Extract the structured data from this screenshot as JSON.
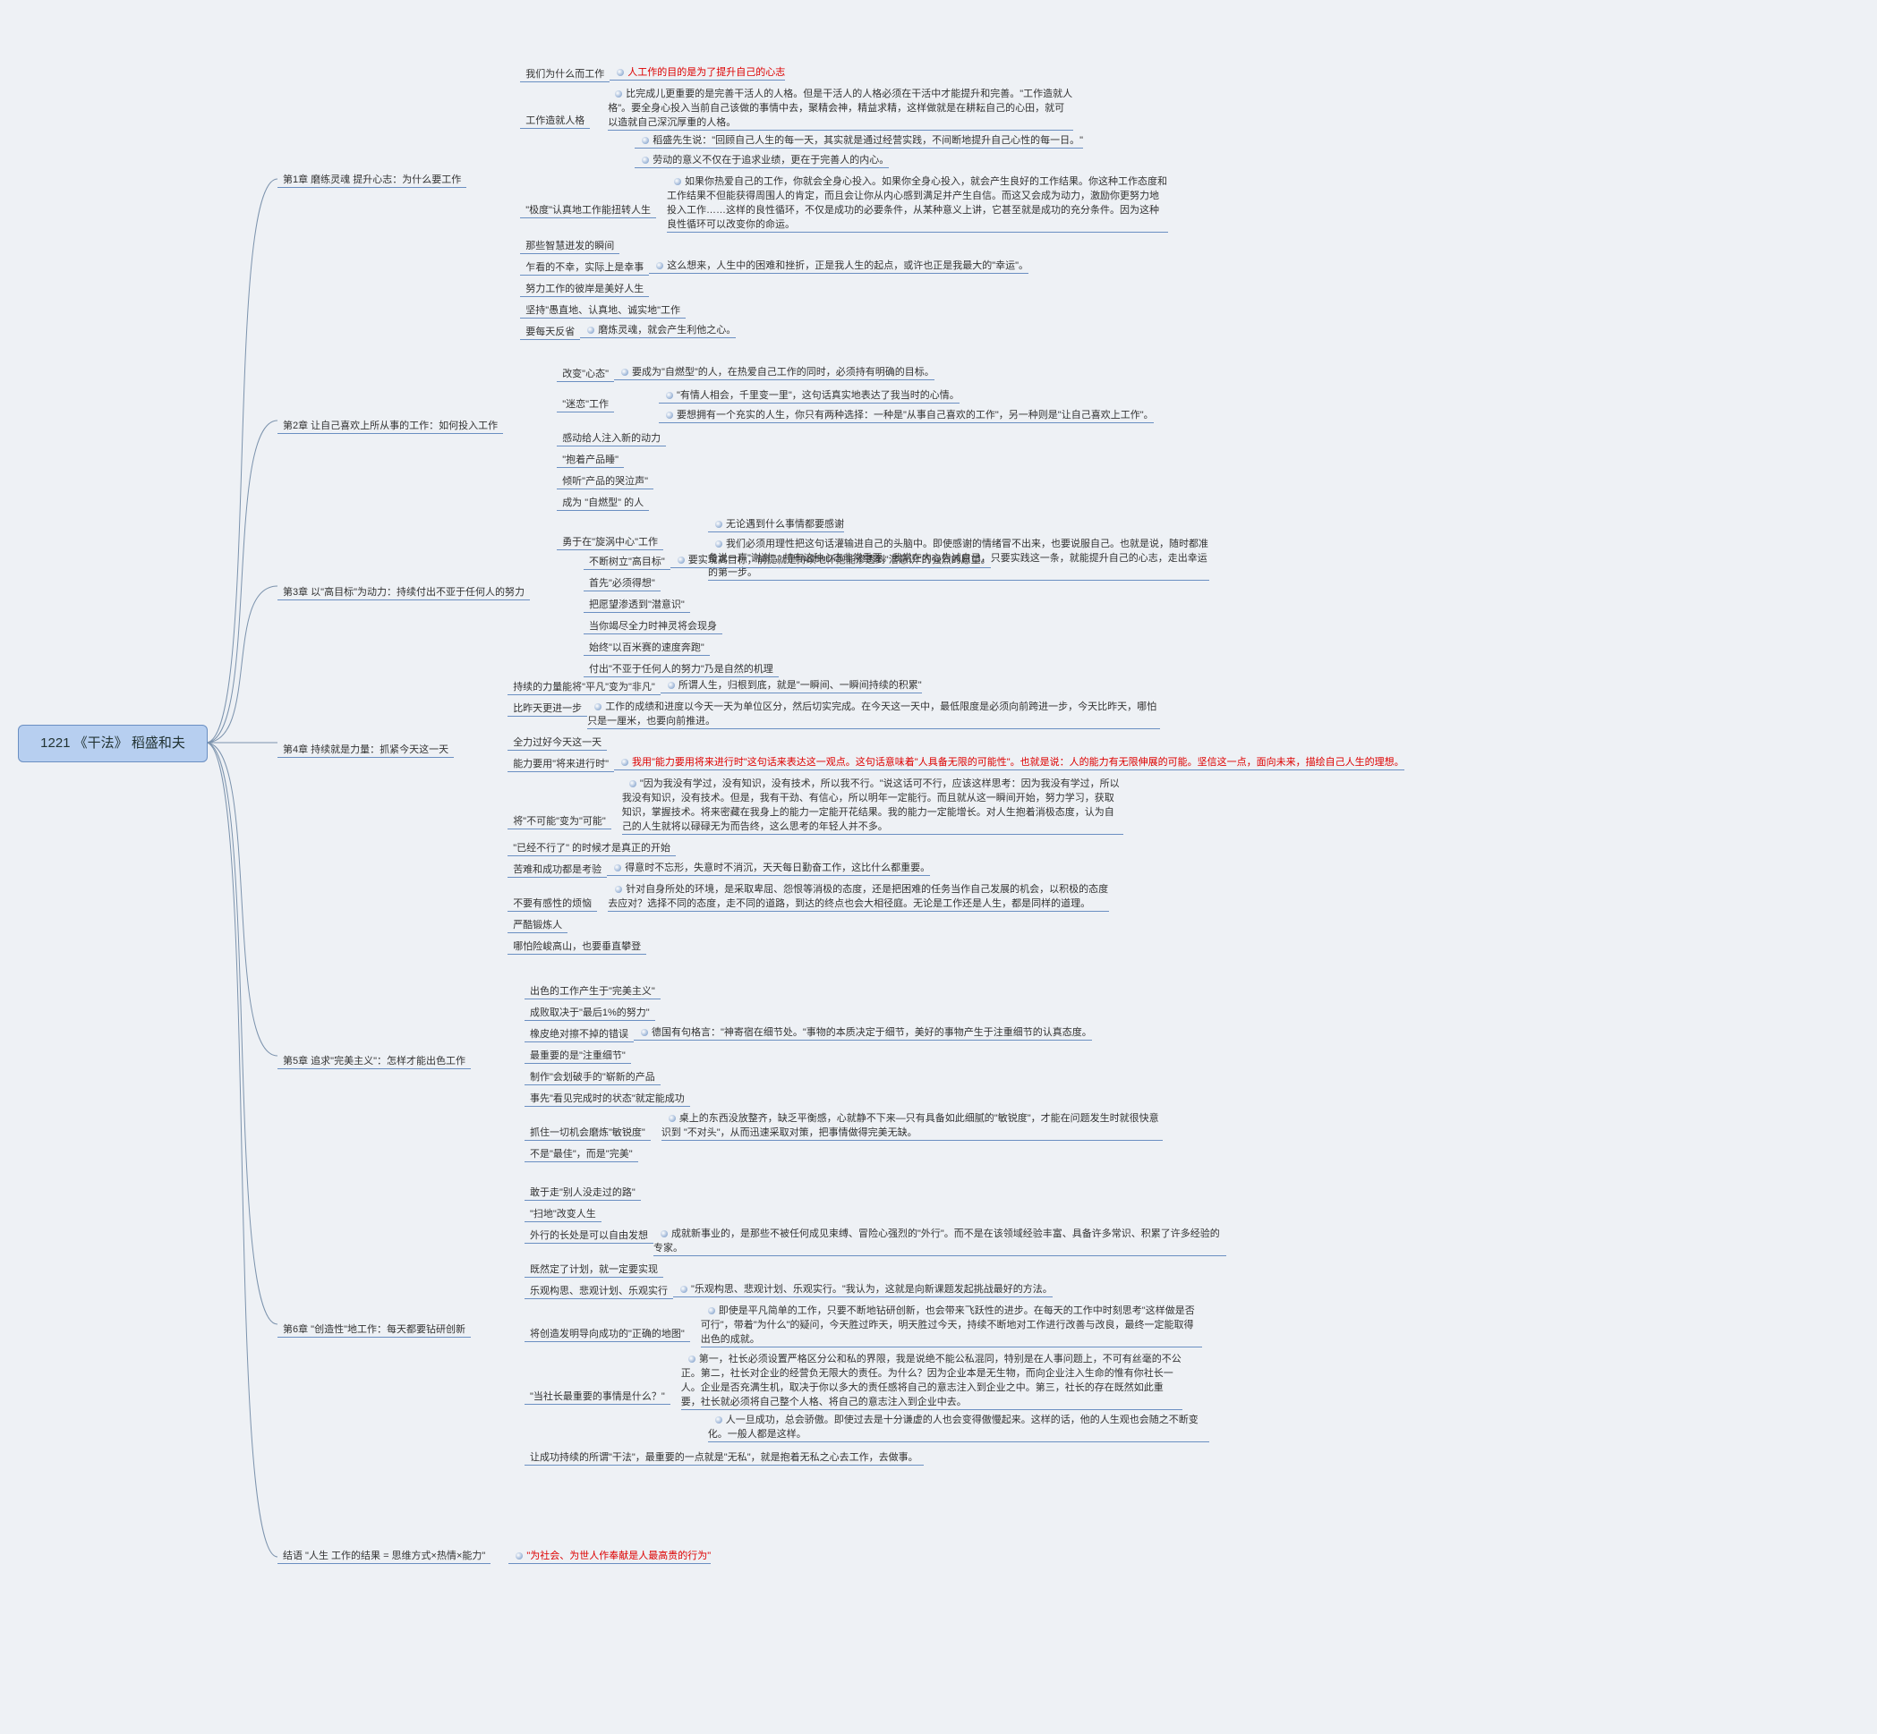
{
  "root": "1221  《干法》  稻盛和夫",
  "chapters": [
    {
      "label": "第1章 磨练灵魂 提升心志：为什么要工作"
    },
    {
      "label": "第2章 让自己喜欢上所从事的工作：如何投入工作"
    },
    {
      "label": "第3章 以\"高目标\"为动力：持续付出不亚于任何人的努力"
    },
    {
      "label": "第4章 持续就是力量：抓紧今天这一天"
    },
    {
      "label": "第5章 追求\"完美主义\"：怎样才能出色工作"
    },
    {
      "label": "第6章 \"创造性\"地工作：每天都要钻研创新"
    },
    {
      "label": "结语 \"人生 工作的结果 = 思维方式×热情×能力\""
    }
  ],
  "c1": {
    "n1": {
      "t": "我们为什么而工作",
      "a": "人工作的目的是为了提升自己的心志"
    },
    "n2": {
      "t": "工作造就人格",
      "a": "比完成儿更重要的是完善干活人的人格。但是干活人的人格必须在干活中才能提升和完善。\"工作造就人格\"。要全身心投入当前自己该做的事情中去，聚精会神，精益求精，这样做就是在耕耘自己的心田，就可以造就自己深沉厚重的人格。",
      "s1": "稻盛先生说：\"回顾自己人生的每一天，其实就是通过经营实践，不间断地提升自己心性的每一日。\"",
      "s2": "劳动的意义不仅在于追求业绩，更在于完善人的内心。"
    },
    "n3": {
      "t": "\"极度\"认真地工作能扭转人生",
      "a": "如果你热爱自己的工作，你就会全身心投入。如果你全身心投入，就会产生良好的工作结果。你这种工作态度和工作结果不但能获得周围人的肯定，而且会让你从内心感到满足并产生自信。而这又会成为动力，激励你更努力地投入工作……这样的良性循环，不仅是成功的必要条件，从某种意义上讲，它甚至就是成功的充分条件。因为这种良性循环可以改变你的命运。"
    },
    "n4": "那些智慧迸发的瞬间",
    "n5": {
      "t": "乍看的不幸，实际上是幸事",
      "a": "这么想来，人生中的困难和挫折，正是我人生的起点，或许也正是我最大的\"幸运\"。"
    },
    "n6": "努力工作的彼岸是美好人生",
    "n7": "坚持\"愚直地、认真地、诚实地\"工作",
    "n8": {
      "t": "要每天反省",
      "a": "磨炼灵魂，就会产生利他之心。"
    }
  },
  "c2": {
    "n1": {
      "t": "改变\"心态\"",
      "a": "要成为\"自燃型\"的人，在热爱自己工作的同时，必须持有明确的目标。"
    },
    "n2": {
      "t": "\"迷恋\"工作",
      "s1": "\"有情人相会，千里变一里\"，这句话真实地表达了我当时的心情。",
      "s2": "要想拥有一个充实的人生，你只有两种选择：一种是\"从事自己喜欢的工作\"，另一种则是\"让自己喜欢上工作\"。"
    },
    "n3": "感动给人注入新的动力",
    "n4": "\"抱着产品睡\"",
    "n5": "倾听\"产品的哭泣声\"",
    "n6": "成为 \"自燃型\" 的人",
    "n7": {
      "t": "勇于在\"旋涡中心\"工作",
      "s1": "无论遇到什么事情都要感谢",
      "s2": "我们必须用理性把这句话灌输进自己的头脑中。即使感谢的情绪冒不出来，也要说服自己。也就是说，随时都准备说一声\"谢谢\"，持有这种心态非常重要。我常在内心告诫自己，只要实践这一条，就能提升自己的心志，走出幸运的第一步。"
    }
  },
  "c3": {
    "n1": {
      "t": "不断树立\"高目标\"",
      "a": "要实现高目标，前提就是持续地怀抱能渗透到\"潜意识\"的强烈的愿望。"
    },
    "n2": "首先\"必须得想\"",
    "n3": "把愿望渗透到\"潜意识\"",
    "n4": "当你竭尽全力时神灵将会现身",
    "n5": "始终\"以百米赛的速度奔跑\"",
    "n6": "付出\"不亚于任何人的努力\"乃是自然的机理"
  },
  "c4": {
    "n1": {
      "t": "持续的力量能将\"平凡\"变为\"非凡\"",
      "a": "所谓人生，归根到底，就是\"一瞬间、一瞬间持续的积累\""
    },
    "n2": {
      "t": "比昨天更进一步",
      "a": "工作的成绩和进度以今天一天为单位区分，然后切实完成。在今天这一天中，最低限度是必须向前跨进一步，今天比昨天，哪怕只是一厘米，也要向前推进。"
    },
    "n3": "全力过好今天这一天",
    "n4": {
      "t": "能力要用\"将来进行时\"",
      "a": "我用\"能力要用将来进行时\"这句话来表达这一观点。这句话意味着\"人具备无限的可能性\"。也就是说：人的能力有无限伸展的可能。坚信这一点，面向未来，描绘自己人生的理想。"
    },
    "n5": {
      "t": "将\"不可能\"变为\"可能\"",
      "a": "\"因为我没有学过，没有知识，没有技术，所以我不行。\"说这话可不行，应该这样思考：因为我没有学过，所以我没有知识，没有技术。但是，我有干劲、有信心，所以明年一定能行。而且就从这一瞬间开始，努力学习，获取知识，掌握技术。将来密藏在我身上的能力一定能开花结果。我的能力一定能增长。对人生抱着消极态度，认为自己的人生就将以碌碌无为而告终，这么思考的年轻人并不多。"
    },
    "n6": "\"已经不行了\" 的时候才是真正的开始",
    "n7": {
      "t": "苦难和成功都是考验",
      "a": "得意时不忘形，失意时不消沉，天天每日勤奋工作，这比什么都重要。"
    },
    "n8": {
      "t": "不要有感性的烦恼",
      "a": "针对自身所处的环境，是采取卑屈、怨恨等消极的态度，还是把困难的任务当作自己发展的机会，以积极的态度去应对？选择不同的态度，走不同的道路，到达的终点也会大相径庭。无论是工作还是人生，都是同样的道理。"
    },
    "n9": "严酷锻炼人",
    "n10": "哪怕险峻高山，也要垂直攀登"
  },
  "c5": {
    "n1": "出色的工作产生于\"完美主义\"",
    "n2": "成败取决于\"最后1%的努力\"",
    "n3": {
      "t": "橡皮绝对擦不掉的错误",
      "a": "德国有句格言：\"神寄宿在细节处。\"事物的本质决定于细节，美好的事物产生于注重细节的认真态度。"
    },
    "n4": "最重要的是\"注重细节\"",
    "n5": "制作\"会划破手的\"崭新的产品",
    "n6": "事先\"看见完成时的状态\"就定能成功",
    "n7": {
      "t": "抓住一切机会磨炼\"敏锐度\"",
      "a": "桌上的东西没放整齐，缺乏平衡感，心就静不下来—只有具备如此细腻的\"敏锐度\"，才能在问题发生时就很快意识到 \"不对头\"，从而迅速采取对策，把事情做得完美无缺。"
    },
    "n8": "不是\"最佳\"，而是\"完美\""
  },
  "c6": {
    "n1": "敢于走\"别人没走过的路\"",
    "n2": "\"扫地\"改变人生",
    "n3": {
      "t": "外行的长处是可以自由发想",
      "a": "成就新事业的，是那些不被任何成见束缚、冒险心强烈的\"外行\"。而不是在该领域经验丰富、具备许多常识、积累了许多经验的专家。"
    },
    "n4": "既然定了计划，就一定要实现",
    "n5": {
      "t": "乐观构思、悲观计划、乐观实行",
      "a": "\"乐观构思、悲观计划、乐观实行。\"我认为，这就是向新课题发起挑战最好的方法。"
    },
    "n6": {
      "t": "将创造发明导向成功的\"正确的地图\"",
      "a": "即使是平凡简单的工作，只要不断地钻研创新，也会带来飞跃性的进步。在每天的工作中时刻思考\"这样做是否可行\"，带着\"为什么\"的疑问，今天胜过昨天，明天胜过今天，持续不断地对工作进行改善与改良，最终一定能取得出色的成就。"
    },
    "n7": {
      "t": "\"当社长最重要的事情是什么？\"",
      "a": "第一，社长必须设置严格区分公和私的界限，我是说绝不能公私混同，特别是在人事问题上，不可有丝毫的不公正。第二，社长对企业的经营负无限大的责任。为什么？因为企业本是无生物，而向企业注入生命的惟有你社长一人。企业是否充满生机，取决于你以多大的责任感将自己的意志注入到企业之中。第三，社长的存在既然如此重要，社长就必须将自己整个人格、将自己的意志注入到企业中去。",
      "s": "人一旦成功，总会骄傲。即使过去是十分谦虚的人也会变得傲慢起来。这样的话，他的人生观也会随之不断变化。一般人都是这样。"
    },
    "n8": "让成功持续的所谓\"干法\"，最重要的一点就是\"无私\"，就是抱着无私之心去工作，去做事。"
  },
  "c7": {
    "a": "\"为社会、为世人作奉献是人最高贵的行为\""
  }
}
